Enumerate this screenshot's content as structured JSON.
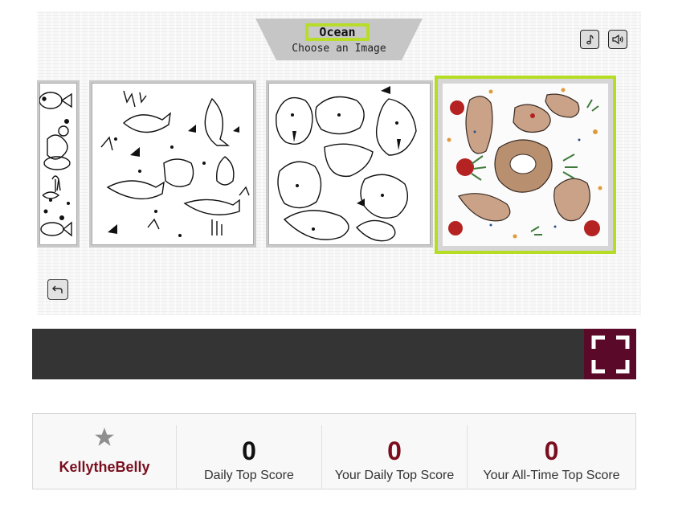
{
  "header": {
    "category_title": "Ocean",
    "subtitle": "Choose an Image"
  },
  "controls": {
    "music_icon": "music-note-icon",
    "sound_icon": "speaker-icon",
    "back_icon": "undo-arrow-icon",
    "fullscreen_icon": "fullscreen-icon"
  },
  "gallery": {
    "images": [
      {
        "name": "ocean-partial",
        "selected": false
      },
      {
        "name": "sharks",
        "selected": false
      },
      {
        "name": "walruses",
        "selected": false
      },
      {
        "name": "otters",
        "selected": true
      }
    ]
  },
  "scoreboard": {
    "username": "KellytheBelly",
    "daily_top_score": "0",
    "daily_top_score_label": "Daily Top Score",
    "your_daily_top_score": "0",
    "your_daily_top_score_label": "Your Daily Top Score",
    "your_all_time_top_score": "0",
    "your_all_time_top_score_label": "Your All-Time Top Score"
  },
  "colors": {
    "accent_green": "#b5dd24",
    "score_red": "#7a0e1e",
    "fullscreen_bg": "#5a0a28",
    "bar_bg": "#343434"
  }
}
